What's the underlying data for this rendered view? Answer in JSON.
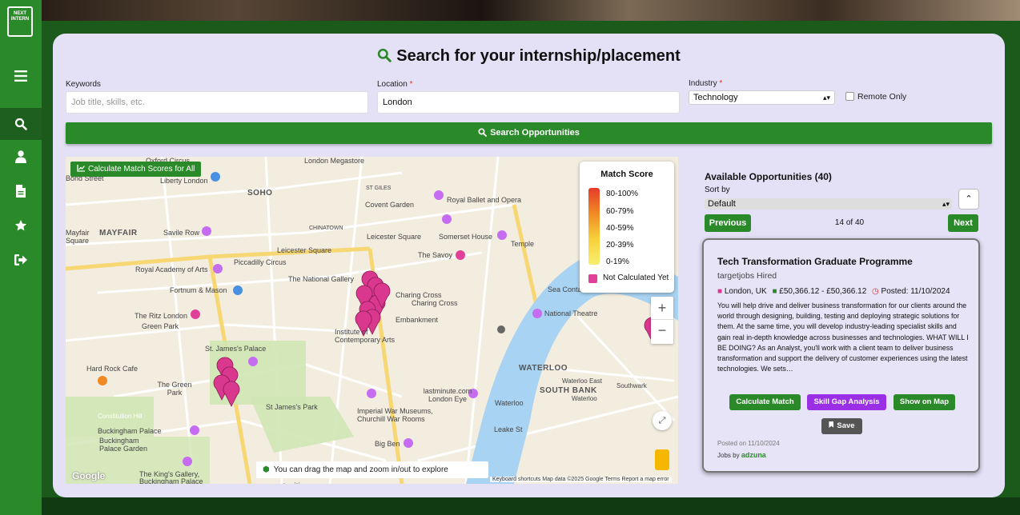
{
  "app": {
    "logo_text": "NEXT INTERN"
  },
  "sidebar": {
    "items": [
      {
        "name": "menu-icon",
        "label": "Menu"
      },
      {
        "name": "search-icon",
        "label": "Search"
      },
      {
        "name": "user-icon",
        "label": "Profile"
      },
      {
        "name": "document-icon",
        "label": "Documents"
      },
      {
        "name": "star-icon",
        "label": "Saved"
      },
      {
        "name": "logout-icon",
        "label": "Logout"
      }
    ]
  },
  "search": {
    "title": "Search for your internship/placement",
    "keywords_label": "Keywords",
    "keywords_placeholder": "Job title, skills, etc.",
    "keywords_value": "",
    "location_label": "Location",
    "location_value": "London",
    "industry_label": "Industry",
    "industry_value": "Technology",
    "remote_label": "Remote Only",
    "remote_checked": false,
    "button_label": "Search Opportunities",
    "required_marker": "*"
  },
  "map": {
    "calc_all_label": "Calculate Match Scores for All",
    "legend": {
      "title": "Match Score",
      "ranges": [
        "80-100%",
        "60-79%",
        "40-59%",
        "20-39%",
        "0-19%"
      ],
      "not_calculated": "Not Calculated Yet",
      "colors": {
        "high": "#e53b2a",
        "low": "#f7ee6e",
        "not_calculated": "#e0409a"
      }
    },
    "zoom_in": "+",
    "zoom_out": "−",
    "tip": "You can drag the map and zoom in/out to explore opportunities",
    "attribution": "Keyboard shortcuts   Map data ©2025 Google   Terms   Report a map error",
    "google": "Google",
    "labels": [
      "Oxford Circus",
      "London Megastore",
      "Liberty London",
      "SOHO",
      "ST GILES",
      "Covent Garden",
      "Royal Ballet and Opera",
      "MAYFAIR",
      "Savile Row",
      "CHINATOWN",
      "Leicester Square",
      "Somerset House",
      "Temple",
      "Leicester Square",
      "The Savoy",
      "Piccadilly Circus",
      "Royal Academy of Arts",
      "The National Gallery",
      "Charing Cross",
      "Charing Cross",
      "Fortnum & Mason",
      "National Theatre",
      "The Ritz London",
      "Green Park",
      "Embankment",
      "Institute of Contemporary Arts",
      "St. James's Palace",
      "Hard Rock Cafe",
      "The Green Park",
      "WATERLOO",
      "Waterloo East",
      "Southwark",
      "SOUTH BANK",
      "Waterloo",
      "lastminute.com London Eye",
      "Waterloo",
      "St James's Park",
      "Imperial War Museums, Churchill War Rooms",
      "Constitution Hill",
      "Buckingham Palace",
      "Buckingham Palace Garden",
      "Leake St",
      "Big Ben",
      "The King's Gallery, Buckingham Palace",
      "Bond Street",
      "Mayfair Square",
      "Sea Containers"
    ]
  },
  "results": {
    "heading": "Available Opportunities (40)",
    "sort_label": "Sort by",
    "sort_value": "Default",
    "prev_label": "Previous",
    "next_label": "Next",
    "counter": "14 of 40",
    "job": {
      "title": "Tech Transformation Graduate Programme",
      "company": "targetjobs Hired",
      "location": "London, UK",
      "salary": "£50,366.12 - £50,366.12",
      "posted": "Posted: 11/10/2024",
      "description": "You will help drive and deliver business transformation for our clients around the world through designing, building, testing and deploying strategic solutions for them. At the same time, you will develop industry-leading specialist skills and gain real in-depth knowledge across businesses and technologies. WHAT WILL I BE DOING? As an Analyst, you'll work with a client team to deliver business transformation and support the delivery of customer experiences using the latest technologies. We sets…",
      "calc_label": "Calculate Match",
      "skill_label": "Skill Gap Analysis",
      "map_label": "Show on Map",
      "save_label": "Save",
      "posted_on": "Posted on 11/10/2024",
      "jobs_by": "Jobs by",
      "provider": "adzuna"
    }
  }
}
